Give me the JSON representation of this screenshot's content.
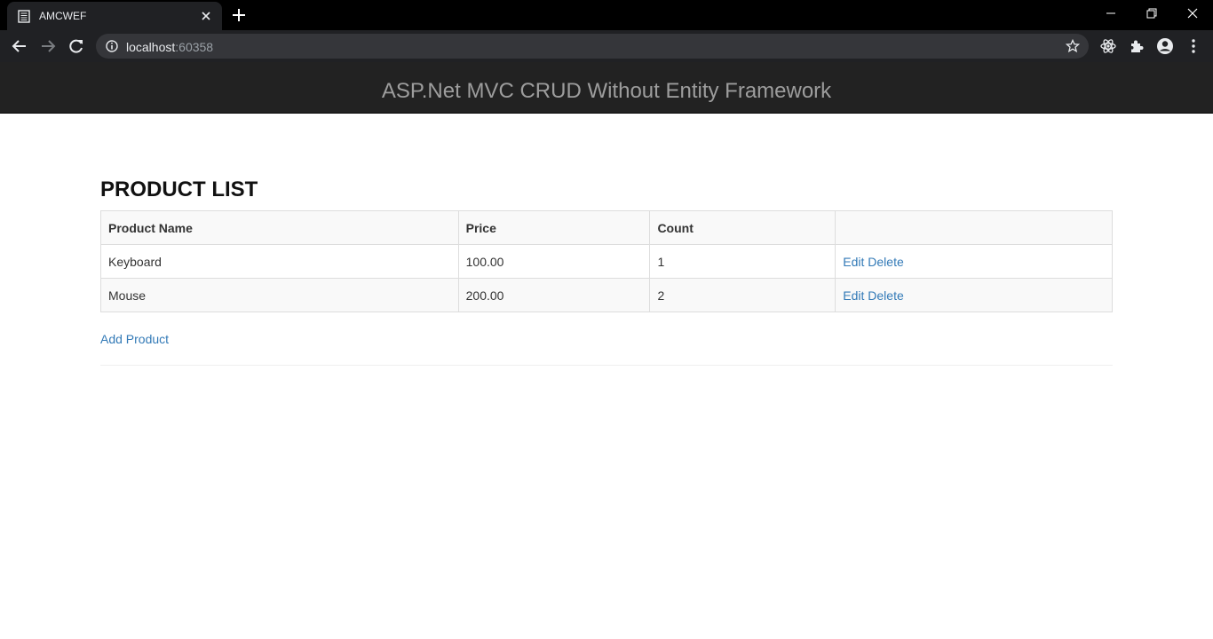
{
  "browser": {
    "tab_title": "AMCWEF",
    "url_host": "localhost",
    "url_port": ":60358"
  },
  "navbar": {
    "brand": "ASP.Net MVC CRUD Without Entity Framework"
  },
  "page": {
    "heading": "PRODUCT LIST",
    "columns": [
      "Product Name",
      "Price",
      "Count",
      ""
    ],
    "rows": [
      {
        "name": "Keyboard",
        "price": "100.00",
        "count": "1"
      },
      {
        "name": "Mouse",
        "price": "200.00",
        "count": "2"
      }
    ],
    "edit_label": "Edit",
    "delete_label": "Delete",
    "add_label": "Add Product"
  },
  "colors": {
    "navbar_bg": "#222222",
    "link": "#337ab7",
    "brand_text": "#9d9d9d"
  }
}
